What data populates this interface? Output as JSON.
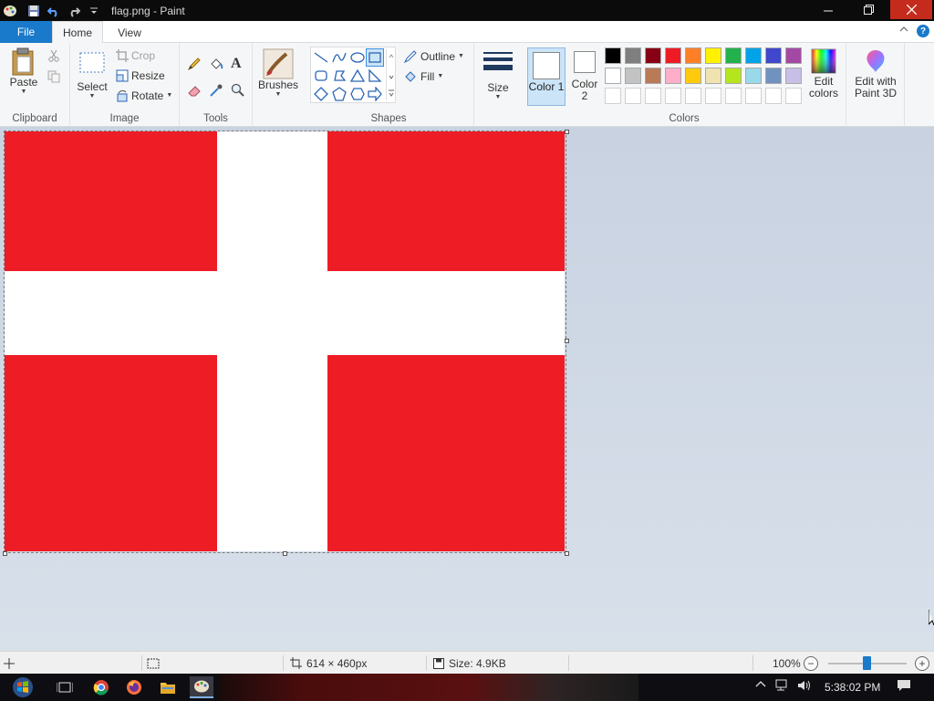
{
  "window": {
    "title": "flag.png - Paint"
  },
  "tabs": {
    "file": "File",
    "home": "Home",
    "view": "View"
  },
  "ribbon": {
    "clipboard": {
      "label": "Clipboard",
      "paste": "Paste"
    },
    "image": {
      "label": "Image",
      "select": "Select",
      "crop": "Crop",
      "resize": "Resize",
      "rotate": "Rotate"
    },
    "tools": {
      "label": "Tools"
    },
    "brushes": {
      "label": "Brushes"
    },
    "shapes": {
      "label": "Shapes",
      "outline": "Outline",
      "fill": "Fill"
    },
    "size": {
      "label": "Size"
    },
    "colors": {
      "label": "Colors",
      "color1": "Color 1",
      "color2": "Color 2",
      "edit_colors": "Edit colors",
      "edit_3d": "Edit with Paint 3D",
      "palette": [
        "#000000",
        "#7f7f7f",
        "#880015",
        "#ed1c24",
        "#ff7f27",
        "#fff200",
        "#22b14c",
        "#00a2e8",
        "#3f48cc",
        "#a349a4",
        "#ffffff",
        "#c3c3c3",
        "#b97a57",
        "#ffaec9",
        "#ffc90e",
        "#efe4b0",
        "#b5e61d",
        "#99d9ea",
        "#7092be",
        "#c8bfe7",
        "#ffffff",
        "#ffffff",
        "#ffffff",
        "#ffffff",
        "#ffffff",
        "#ffffff",
        "#ffffff",
        "#ffffff",
        "#ffffff",
        "#ffffff"
      ]
    }
  },
  "canvas": {
    "flag_red": "#ee1c25",
    "flag_white": "#ffffff"
  },
  "status": {
    "dimensions": "614 × 460px",
    "size": "Size: 4.9KB",
    "zoom": "100%"
  },
  "taskbar": {
    "time": "5:38:02 PM"
  }
}
